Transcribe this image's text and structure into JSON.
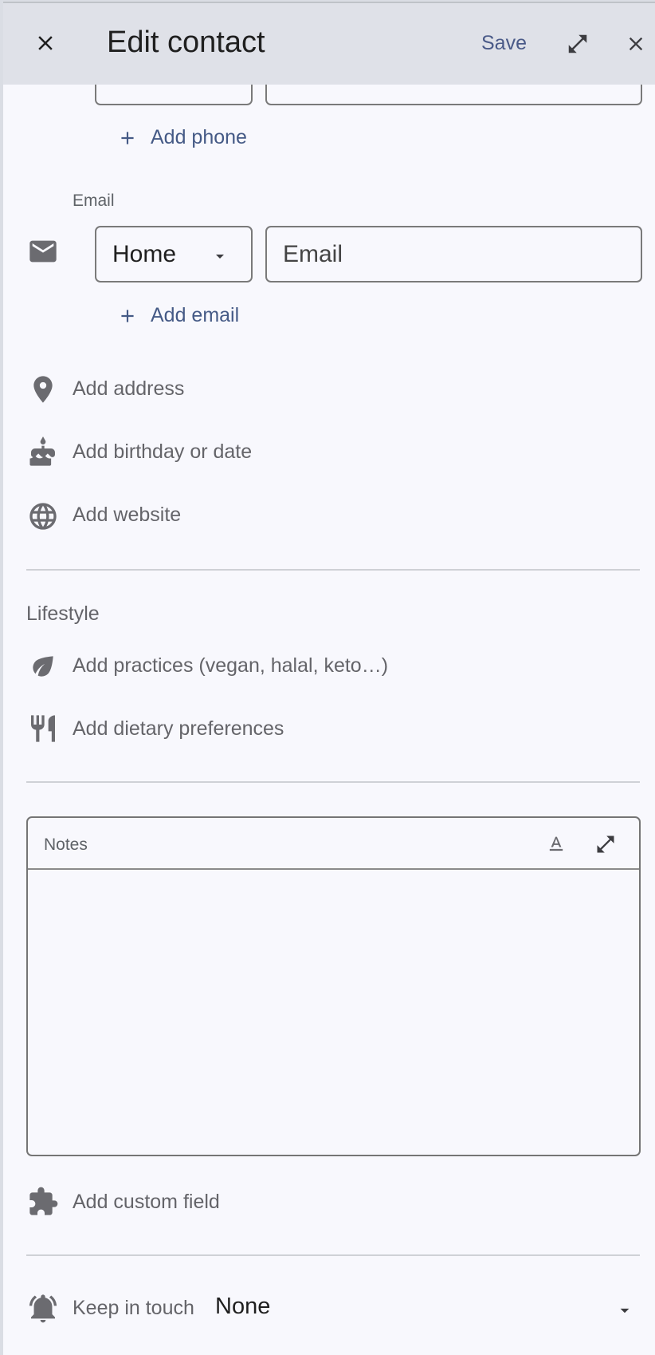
{
  "header": {
    "title": "Edit contact",
    "save_label": "Save"
  },
  "phone": {
    "add_label": "Add phone"
  },
  "email": {
    "section_label": "Email",
    "type_value": "Home",
    "placeholder": "Email",
    "add_label": "Add email"
  },
  "rows": {
    "address": "Add address",
    "birthday": "Add birthday or date",
    "website": "Add website"
  },
  "lifestyle": {
    "heading": "Lifestyle",
    "practices": "Add practices (vegan, halal, keto…)",
    "dietary": "Add dietary preferences"
  },
  "notes": {
    "label": "Notes"
  },
  "custom_field": {
    "label": "Add custom field"
  },
  "keep_in_touch": {
    "label": "Keep in touch",
    "value": "None"
  },
  "colors": {
    "accent": "#455a86",
    "header_bg": "#dfe1e8",
    "page_bg": "#f8f8fd",
    "icon_gray": "#6b6b70"
  },
  "icons": {
    "header_close": "close-icon",
    "expand": "expand-icon",
    "panel_close": "close-icon",
    "email": "mail-icon",
    "address": "location-pin-icon",
    "birthday": "cake-icon",
    "website": "globe-icon",
    "practices": "leaf-icon",
    "dietary": "restaurant-icon",
    "custom_field": "puzzle-icon",
    "keep_in_touch": "bell-icon"
  }
}
